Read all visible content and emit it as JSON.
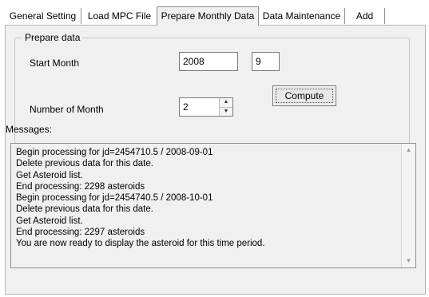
{
  "tabs": [
    {
      "label": "General Setting"
    },
    {
      "label": "Load MPC File"
    },
    {
      "label": "Prepare Monthly Data"
    },
    {
      "label": "Data Maintenance"
    },
    {
      "label": "Add"
    }
  ],
  "active_tab_index": 2,
  "prepare_data": {
    "group_title": "Prepare data",
    "start_month_label": "Start Month",
    "start_year_value": "2008",
    "start_month_value": "9",
    "number_of_month_label": "Number of Month",
    "number_of_month_value": "2",
    "compute_label": "Compute"
  },
  "messages": {
    "label": "Messages:",
    "lines": [
      "Begin processing for jd=2454710.5 / 2008-09-01",
      "Delete previous data for this date.",
      "Get Asteroid list.",
      "End processing: 2298 asteroids",
      "Begin processing for jd=2454740.5 / 2008-10-01",
      "Delete previous data for this date.",
      "Get Asteroid list.",
      "End processing: 2297 asteroids",
      "You are now ready to display the asteroid for this time period."
    ]
  },
  "icons": {
    "spin_up": "spin-up-arrow",
    "spin_down": "spin-down-arrow",
    "scroll_up": "scroll-up-arrow",
    "scroll_down": "scroll-down-arrow"
  }
}
